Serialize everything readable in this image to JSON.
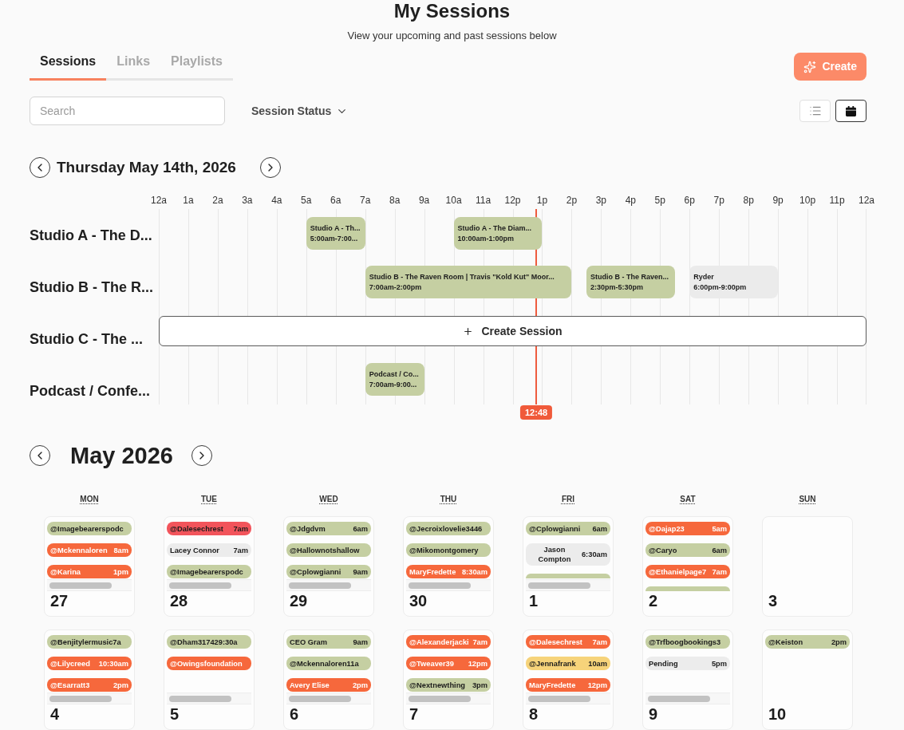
{
  "header": {
    "title": "My Sessions",
    "subtitle": "View your upcoming and past sessions below"
  },
  "tabs": [
    {
      "label": "Sessions",
      "selected": true
    },
    {
      "label": "Links",
      "selected": false
    },
    {
      "label": "Playlists",
      "selected": false
    }
  ],
  "create_button": {
    "label": "Create"
  },
  "search": {
    "placeholder": "Search"
  },
  "status_filter": {
    "label": "Session Status"
  },
  "view_toggles": [
    {
      "kind": "list",
      "selected": false
    },
    {
      "kind": "calendar",
      "selected": true
    }
  ],
  "day_view": {
    "date": "Thursday May 14th, 2026",
    "hours": [
      "12a",
      "1a",
      "2a",
      "3a",
      "4a",
      "5a",
      "6a",
      "7a",
      "8a",
      "9a",
      "10a",
      "11a",
      "12p",
      "1p",
      "2p",
      "3p",
      "4p",
      "5p",
      "6p",
      "7p",
      "8p",
      "9p",
      "10p",
      "11p",
      "12a"
    ],
    "rooms": [
      {
        "name": "Studio A - The D...",
        "events": [
          {
            "title": "Studio A - Th...",
            "time": "5:00am-7:00...",
            "color": "#c5cfa2"
          },
          {
            "title": "Studio A - The Diam...",
            "time": "10:00am-1:00pm",
            "color": "#c5cfa2"
          }
        ]
      },
      {
        "name": "Studio B - The R...",
        "events": [
          {
            "title": "Studio B - The Raven Room | Travis \"Kold Kut\" Moor...",
            "time": "7:00am-2:00pm",
            "color": "#c5cfa2"
          },
          {
            "title": "Studio B - The Raven...",
            "time": "2:30pm-5:30pm",
            "color": "#c5cfa2"
          },
          {
            "title": "Ryder",
            "time": "6:00pm-9:00pm",
            "color": "#ebebeb"
          }
        ]
      },
      {
        "name": "Studio C - The ...",
        "action": {
          "label": "Create Session"
        }
      },
      {
        "name": "Podcast / Confe...",
        "events": [
          {
            "title": "Podcast / Co...",
            "time": "7:00am-9:00...",
            "color": "#c5cfa2"
          }
        ]
      }
    ],
    "now_marker": {
      "label": "12:48"
    }
  },
  "month_view": {
    "month": "May 2026",
    "weekdays": [
      "MON",
      "TUE",
      "WED",
      "THU",
      "FRI",
      "SAT",
      "SUN"
    ],
    "weeks": [
      {
        "days": [
          {
            "number": "27",
            "scrollbar": true,
            "sessions": [
              {
                "name": "@Imagebearerspodc",
                "color": "#c5cfa2"
              },
              {
                "name": "@Mckennaloren",
                "time": "8am",
                "color": "#f6683c"
              },
              {
                "name": "@Karina",
                "time": "1pm",
                "color": "#f6683c"
              }
            ]
          },
          {
            "number": "28",
            "scrollbar": true,
            "sessions": [
              {
                "name": "@Dalesechrest",
                "time": "7am",
                "color": "#f2545b"
              },
              {
                "name": "Lacey Connor",
                "time": "7am",
                "color": "#ececec"
              },
              {
                "name": "@Imagebearerspodc",
                "color": "#c5cfa2"
              }
            ]
          },
          {
            "number": "29",
            "scrollbar": true,
            "sessions": [
              {
                "name": "@Jdgdvm",
                "time": "6am",
                "color": "#c5cfa2"
              },
              {
                "name": "@Hallownotshallow",
                "color": "#c5cfa2"
              },
              {
                "name": "@Cplowgianni",
                "time": "9am",
                "color": "#c5cfa2"
              }
            ]
          },
          {
            "number": "30",
            "scrollbar": true,
            "sessions": [
              {
                "name": "@Jecroixlovelie3446",
                "color": "#c5cfa2"
              },
              {
                "name": "@Mikomontgomery",
                "color": "#c5cfa2"
              },
              {
                "name": "MaryFredette",
                "time": "8:30am",
                "color": "#f6683c"
              }
            ]
          },
          {
            "number": "1",
            "scrollbar": true,
            "sessions": [
              {
                "name": "@Cplowgianni",
                "time": "6am",
                "color": "#c5cfa2"
              },
              {
                "name": "Jason Compton",
                "time": "6:30am",
                "color": "#ececec"
              },
              {
                "color": "#c5cfa2"
              }
            ]
          },
          {
            "number": "2",
            "scrollbar": false,
            "sessions": [
              {
                "name": "@Dajap23",
                "time": "5am",
                "color": "#f6683c"
              },
              {
                "name": "@Caryo",
                "time": "6am",
                "color": "#c5cfa2"
              },
              {
                "name": "@Ethanielpage7",
                "time": "7am",
                "color": "#f6683c"
              },
              {
                "color": "#c5cfa2"
              }
            ]
          },
          {
            "number": "3",
            "scrollbar": false
          }
        ]
      },
      {
        "days": [
          {
            "number": "4",
            "scrollbar": true,
            "sessions": [
              {
                "name": "@Benjitylermusic7a",
                "color": "#c5cfa2"
              },
              {
                "name": "@Lilycreed",
                "time": "10:30am",
                "color": "#f6683c"
              },
              {
                "name": "@Esarratt3",
                "time": "2pm",
                "color": "#f6683c"
              }
            ]
          },
          {
            "number": "5",
            "scrollbar": true,
            "sessions": [
              {
                "name": "@Dham317429:30a",
                "color": "#c5cfa2"
              },
              {
                "name": "@Owingsfoundation",
                "color": "#f6683c"
              }
            ]
          },
          {
            "number": "6",
            "scrollbar": true,
            "sessions": [
              {
                "name": "CEO Gram",
                "time": "9am",
                "color": "#c5cfa2"
              },
              {
                "name": "@Mckennaloren11a",
                "color": "#c5cfa2"
              },
              {
                "name": "Avery Elise",
                "time": "2pm",
                "color": "#f6683c"
              }
            ]
          },
          {
            "number": "7",
            "scrollbar": true,
            "sessions": [
              {
                "name": "@Alexanderjacki",
                "time": "7am",
                "color": "#f6683c"
              },
              {
                "name": "@Tweaver39",
                "time": "12pm",
                "color": "#f6683c"
              },
              {
                "name": "@Nextnewthing",
                "time": "3pm",
                "color": "#c5cfa2"
              }
            ]
          },
          {
            "number": "8",
            "scrollbar": true,
            "sessions": [
              {
                "name": "@Dalesechrest",
                "time": "7am",
                "color": "#f6683c"
              },
              {
                "name": "@Jennafrank",
                "time": "10am",
                "color": "#f6d37a"
              },
              {
                "name": "MaryFredette",
                "time": "12pm",
                "color": "#f6683c"
              }
            ]
          },
          {
            "number": "9",
            "scrollbar": true,
            "sessions": [
              {
                "name": "@Trfboogbookings3",
                "color": "#c5cfa2"
              },
              {
                "name": "Pending",
                "time": "5pm",
                "color": "#ececec"
              }
            ]
          },
          {
            "number": "10",
            "scrollbar": false,
            "sessions": [
              {
                "name": "@Keiston",
                "time": "2pm",
                "color": "#c5cfa2"
              }
            ]
          }
        ]
      }
    ]
  }
}
